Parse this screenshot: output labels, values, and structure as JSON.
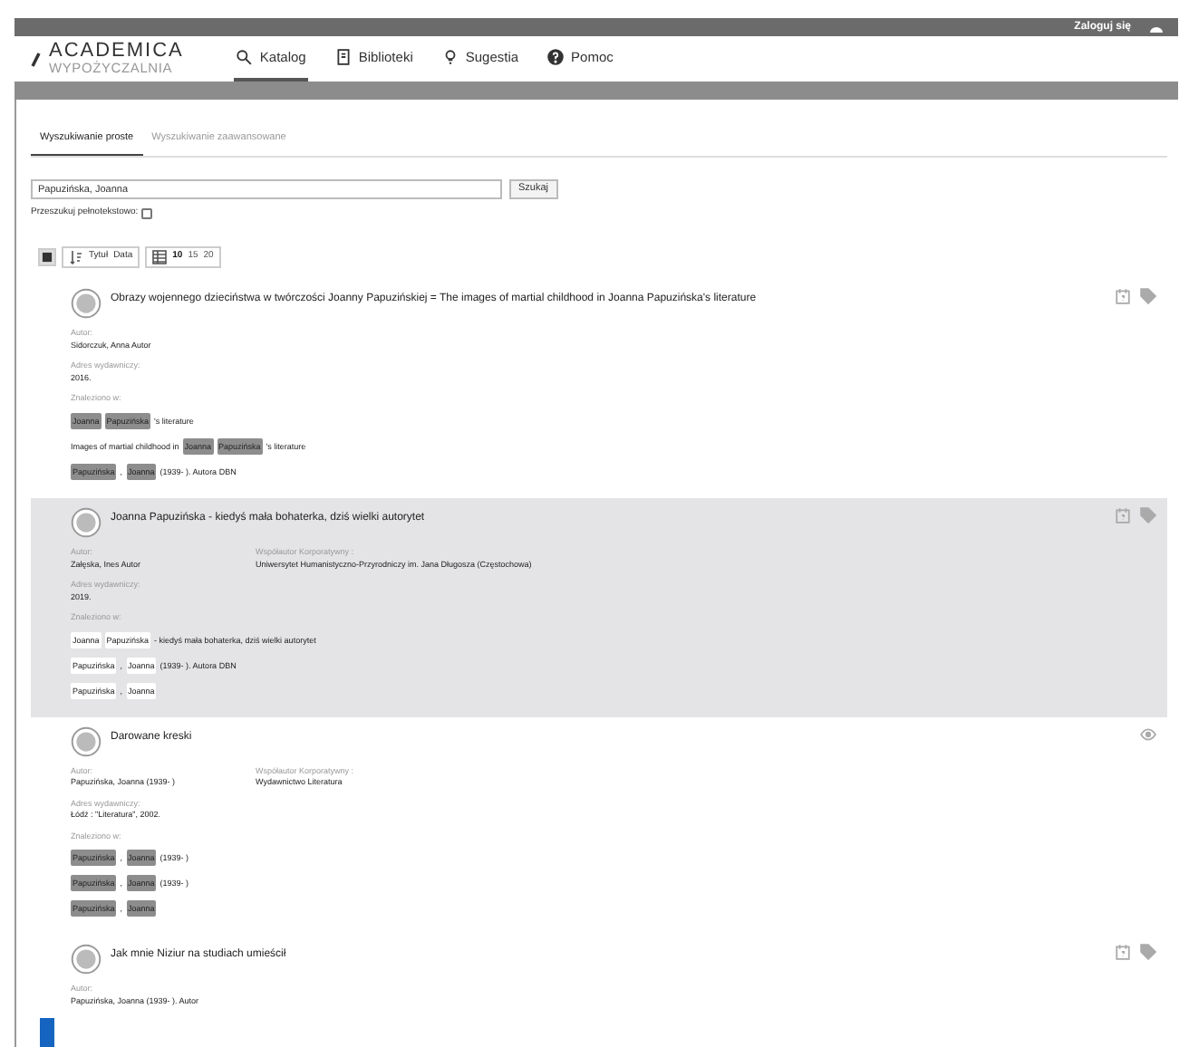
{
  "top_bar": {
    "login": "Zaloguj się"
  },
  "logo": {
    "name": "ACADEMICA",
    "subtitle": "WYPOŻYCZALNIA"
  },
  "nav": [
    {
      "label": "Katalog",
      "selected": true
    },
    {
      "label": "Biblioteki",
      "selected": false
    },
    {
      "label": "Sugestia",
      "selected": false
    },
    {
      "label": "Pomoc",
      "selected": false
    }
  ],
  "search_tabs": [
    {
      "label": "Wyszukiwanie proste",
      "selected": true
    },
    {
      "label": "Wyszukiwanie zaawansowane",
      "selected": false
    }
  ],
  "search": {
    "value": "Papuzińska, Joanna",
    "button": "Szukaj",
    "fulltext_label": "Przeszukuj pełnotekstowo:",
    "fulltext_checked": false
  },
  "toolbar": {
    "sort": [
      "Tytuł",
      "Data"
    ],
    "page_sizes": [
      {
        "label": "10",
        "selected": true
      },
      {
        "label": "15",
        "selected": false
      },
      {
        "label": "20",
        "selected": false
      }
    ]
  },
  "results": [
    {
      "title": "Obrazy wojennego dzieciństwa w twórczości Joanny Papuzińskiej = The images of martial childhood in Joanna Papuzińska's literature",
      "highlighted": false,
      "actions": [
        {
          "kind": "calendar"
        },
        {
          "kind": "tag"
        }
      ],
      "rows": [
        [
          {
            "label": "Autor:",
            "value": "Sidorczuk, Anna Autor"
          }
        ],
        [
          {
            "label": "Adres wydawniczy:",
            "value": "2016."
          }
        ]
      ],
      "found_label": "Znaleziono w:",
      "found": [
        [
          {
            "text": "Joanna",
            "hit": true
          },
          {
            "text": "Papuzińska",
            "hit": true
          },
          {
            "text": "'s literature",
            "hit": false
          }
        ],
        [
          {
            "text": "Images of martial childhood in",
            "hit": false
          },
          {
            "text": "Joanna",
            "hit": true
          },
          {
            "text": "Papuzińska",
            "hit": true
          },
          {
            "text": "'s literature",
            "hit": false
          }
        ],
        [
          {
            "text": "Papuzińska",
            "hit": true
          },
          {
            "text": ",",
            "hit": false
          },
          {
            "text": "Joanna",
            "hit": true
          },
          {
            "text": "(1939- ). Autora DBN",
            "hit": false
          }
        ]
      ]
    },
    {
      "title": "Joanna Papuzińska - kiedyś mała bohaterka, dziś wielki autorytet",
      "highlighted": true,
      "actions": [
        {
          "kind": "calendar"
        },
        {
          "kind": "tag"
        }
      ],
      "rows": [
        [
          {
            "label": "Autor:",
            "value": "Załęska, Ines Autor"
          },
          {
            "label": "Współautor Korporatywny :",
            "value": "Uniwersytet Humanistyczno-Przyrodniczy im. Jana Długosza (Częstochowa)"
          }
        ],
        [
          {
            "label": "Adres wydawniczy:",
            "value": "2019."
          }
        ]
      ],
      "found_label": "Znaleziono w:",
      "found": [
        [
          {
            "text": "Joanna",
            "hit": true
          },
          {
            "text": "Papuzińska",
            "hit": true
          },
          {
            "text": "- kiedyś mała bohaterka, dziś wielki autorytet",
            "hit": false
          }
        ],
        [
          {
            "text": "Papuzińska",
            "hit": true
          },
          {
            "text": ",",
            "hit": false
          },
          {
            "text": "Joanna",
            "hit": true
          },
          {
            "text": "(1939- ). Autora DBN",
            "hit": false
          }
        ],
        [
          {
            "text": "Papuzińska",
            "hit": true
          },
          {
            "text": ",",
            "hit": false
          },
          {
            "text": "Joanna",
            "hit": true
          }
        ]
      ]
    },
    {
      "title": "Darowane kreski",
      "highlighted": false,
      "actions": [
        {
          "kind": "eye"
        }
      ],
      "rows": [
        [
          {
            "label": "Autor:",
            "value": "Papuzińska, Joanna (1939- )"
          },
          {
            "label": "Współautor Korporatywny :",
            "value": "Wydawnictwo Literatura"
          }
        ],
        [
          {
            "label": "Adres wydawniczy:",
            "value": "Łódź : \"Literatura\", 2002."
          }
        ]
      ],
      "found_label": "Znaleziono w:",
      "found": [
        [
          {
            "text": "Papuzińska",
            "hit": true
          },
          {
            "text": ",",
            "hit": false
          },
          {
            "text": "Joanna",
            "hit": true
          },
          {
            "text": "(1939- )",
            "hit": false
          }
        ],
        [
          {
            "text": "Papuzińska",
            "hit": true
          },
          {
            "text": ",",
            "hit": false
          },
          {
            "text": "Joanna",
            "hit": true
          },
          {
            "text": "(1939- )",
            "hit": false
          }
        ],
        [
          {
            "text": "Papuzińska",
            "hit": true
          },
          {
            "text": ",",
            "hit": false
          },
          {
            "text": "Joanna",
            "hit": true
          }
        ]
      ]
    },
    {
      "title": "Jak mnie Niziur na studiach umieścił",
      "highlighted": false,
      "actions": [
        {
          "kind": "calendar"
        },
        {
          "kind": "tag"
        }
      ],
      "rows": [
        [
          {
            "label": "Autor:",
            "value": "Papuzińska, Joanna (1939- ). Autor"
          }
        ]
      ]
    }
  ]
}
